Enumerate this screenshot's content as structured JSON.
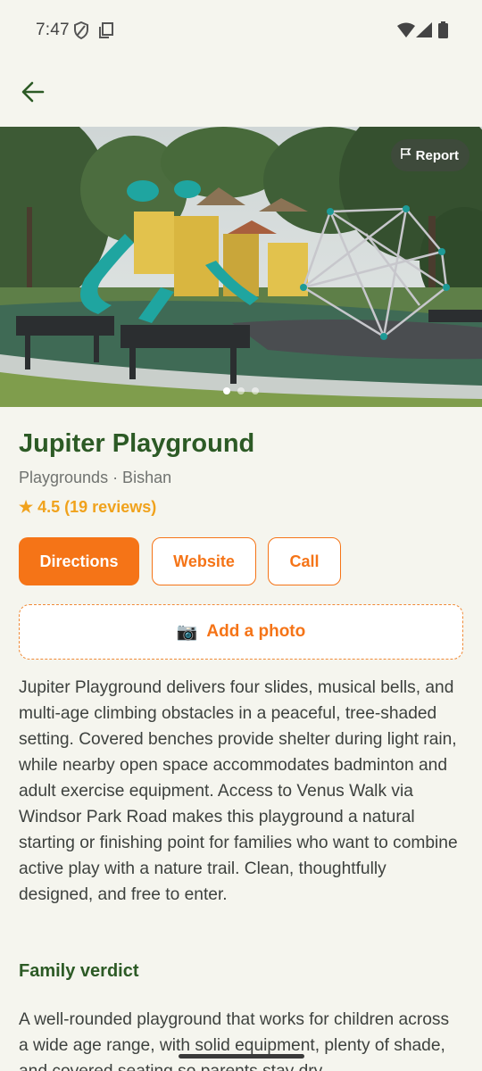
{
  "status_bar": {
    "time": "7:47"
  },
  "photo": {
    "report_label": "Report",
    "page_count": 3,
    "active_index": 0
  },
  "place": {
    "name": "Jupiter Playground",
    "category_line": "Playgrounds · Bishan",
    "rating": "★ 4.5 (19 reviews)"
  },
  "actions": {
    "directions": "Directions",
    "website": "Website",
    "call": "Call"
  },
  "add_photo": {
    "icon": "📷",
    "label": "Add a photo"
  },
  "description": "Jupiter Playground delivers four slides, musical bells, and multi-age climbing obstacles in a peaceful, tree-shaded setting. Covered benches provide shelter during light rain, while nearby open space accommodates badminton and adult exercise equipment. Access to Venus Walk via Windsor Park Road makes this playground a natural starting or finishing point for families who want to combine active play with a nature trail. Clean, thoughtfully designed, and free to enter.",
  "verdict": {
    "heading": "Family verdict",
    "text": "A well-rounded playground that works for children across a wide age range, with solid equipment, plenty of shade, and covered seating so parents stay dry."
  },
  "colors": {
    "accent": "#f57417",
    "title_green": "#2c5a25",
    "rating": "#f0a21c",
    "background": "#f5f5ee"
  }
}
